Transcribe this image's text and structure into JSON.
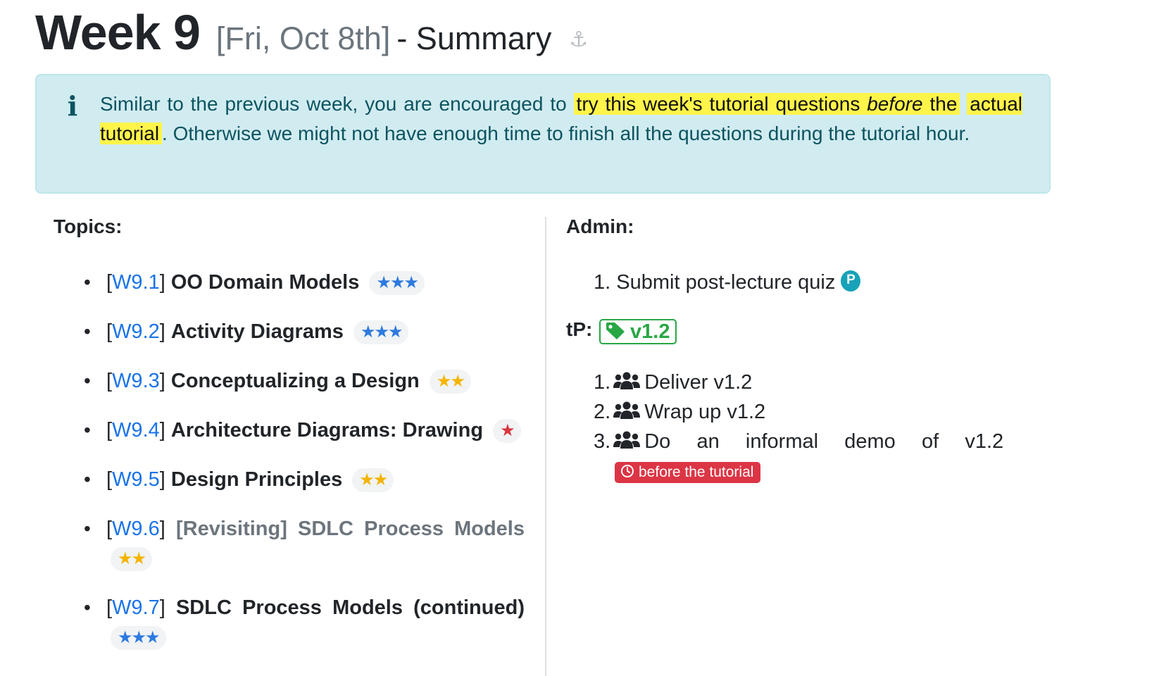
{
  "heading": {
    "week": "Week 9",
    "date": "[Fri, Oct 8th]",
    "summary": "- Summary",
    "anchor_symbol": "⚓"
  },
  "callout": {
    "icon": "info-icon",
    "text_before": "Similar to the previous week, you are encouraged to ",
    "highlight_1": "try this week's tutorial questions ",
    "highlight_italic": "before",
    "highlight_2": " the",
    "highlight_3": "actual tutorial",
    "text_after": ". Otherwise we might not have enough time to finish all the questions during the tutorial hour.",
    "bg_color": "#d1ecf1",
    "text_color": "#0c5460",
    "highlight_color": "#fff44a"
  },
  "topics": {
    "label": "Topics:",
    "bullet": "•",
    "items": [
      {
        "code": "W9.1",
        "name": "OO Domain Models",
        "stars": "★★★",
        "color": "blue"
      },
      {
        "code": "W9.2",
        "name": "Activity Diagrams",
        "stars": "★★★",
        "color": "blue"
      },
      {
        "code": "W9.3",
        "name": "Conceptualizing a Design",
        "stars": "★★",
        "color": "gold"
      },
      {
        "code": "W9.4",
        "name": "Architecture Diagrams: Drawing",
        "stars": "★",
        "color": "red"
      },
      {
        "code": "W9.5",
        "name": "Design Principles",
        "stars": "★★",
        "color": "gold"
      },
      {
        "code": "W9.6",
        "name": "[Revisiting] SDLC Process Models",
        "stars": "★★",
        "color": "gold"
      },
      {
        "code": "W9.7",
        "name": "SDLC Process Models (continued)",
        "stars": "★★★",
        "color": "blue"
      }
    ]
  },
  "admin": {
    "label": "Admin:",
    "items": [
      {
        "num": "1.",
        "text": "Submit post-lecture quiz",
        "badge": "P"
      }
    ]
  },
  "tp": {
    "label": "tP:",
    "tag": "v1.2",
    "tag_icon": "tag-icon",
    "items": [
      {
        "num": "1.",
        "icon": "users-icon",
        "text": "Deliver v1.2"
      },
      {
        "num": "2.",
        "icon": "users-icon",
        "text": "Wrap up v1.2"
      },
      {
        "num": "3.",
        "icon": "users-icon",
        "words": [
          "Do",
          "an",
          "informal",
          "demo",
          "of",
          "v1.2"
        ]
      }
    ],
    "deadline": "before the tutorial",
    "deadline_icon": "clock-icon"
  },
  "colors": {
    "link": "#1a73e8",
    "star_blue": "#2d7ae0",
    "star_gold": "#f4b400",
    "star_red": "#d9363e",
    "tag_green": "#28a745",
    "badge_red": "#dc3545",
    "badge_teal": "#17a2b8"
  }
}
